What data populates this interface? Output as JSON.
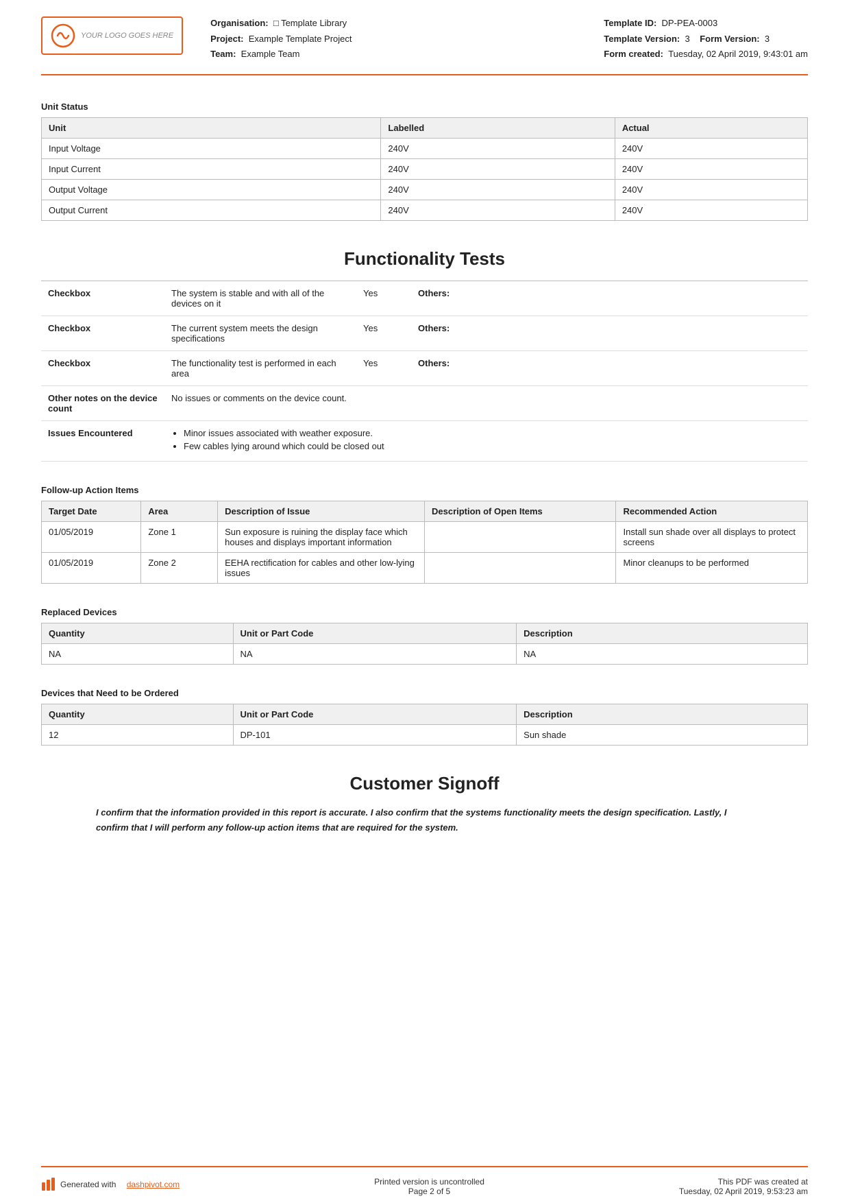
{
  "header": {
    "logo_text": "YOUR LOGO GOES HERE",
    "organisation_label": "Organisation:",
    "organisation_value": "Template Library",
    "project_label": "Project:",
    "project_value": "Example Template Project",
    "team_label": "Team:",
    "team_value": "Example Team",
    "template_id_label": "Template ID:",
    "template_id_value": "DP-PEA-0003",
    "template_version_label": "Template Version:",
    "template_version_value": "3",
    "form_version_label": "Form Version:",
    "form_version_value": "3",
    "form_created_label": "Form created:",
    "form_created_value": "Tuesday, 02 April 2019, 9:43:01 am"
  },
  "unit_status": {
    "section_title": "Unit Status",
    "columns": [
      "Unit",
      "Labelled",
      "Actual"
    ],
    "rows": [
      {
        "unit": "Input Voltage",
        "labelled": "240V",
        "actual": "240V"
      },
      {
        "unit": "Input Current",
        "labelled": "240V",
        "actual": "240V"
      },
      {
        "unit": "Output Voltage",
        "labelled": "240V",
        "actual": "240V"
      },
      {
        "unit": "Output Current",
        "labelled": "240V",
        "actual": "240V"
      }
    ]
  },
  "functionality_tests": {
    "section_title": "Functionality Tests",
    "rows": [
      {
        "field_label": "Checkbox",
        "description": "The system is stable and with all of the devices on it",
        "value": "Yes",
        "others_label": "Others:"
      },
      {
        "field_label": "Checkbox",
        "description": "The current system meets the design specifications",
        "value": "Yes",
        "others_label": "Others:"
      },
      {
        "field_label": "Checkbox",
        "description": "The functionality test is performed in each area",
        "value": "Yes",
        "others_label": "Others:"
      },
      {
        "field_label": "Other notes on the device count",
        "description": "No issues or comments on the device count.",
        "value": "",
        "others_label": ""
      }
    ],
    "issues_label": "Issues Encountered",
    "issues_bullets": [
      "Minor issues associated with weather exposure.",
      "Few cables lying around which could be closed out"
    ]
  },
  "followup": {
    "section_title": "Follow-up Action Items",
    "columns": [
      "Target Date",
      "Area",
      "Description of Issue",
      "Description of Open Items",
      "Recommended Action"
    ],
    "rows": [
      {
        "target_date": "01/05/2019",
        "area": "Zone 1",
        "description": "Sun exposure is ruining the display face which houses and displays important information",
        "open_items": "",
        "recommended": "Install sun shade over all displays to protect screens"
      },
      {
        "target_date": "01/05/2019",
        "area": "Zone 2",
        "description": "EEHA rectification for cables and other low-lying issues",
        "open_items": "",
        "recommended": "Minor cleanups to be performed"
      }
    ]
  },
  "replaced_devices": {
    "section_title": "Replaced Devices",
    "columns": [
      "Quantity",
      "Unit or Part Code",
      "Description"
    ],
    "rows": [
      {
        "quantity": "NA",
        "part_code": "NA",
        "description": "NA"
      }
    ]
  },
  "devices_ordered": {
    "section_title": "Devices that Need to be Ordered",
    "columns": [
      "Quantity",
      "Unit or Part Code",
      "Description"
    ],
    "rows": [
      {
        "quantity": "12",
        "part_code": "DP-101",
        "description": "Sun shade"
      }
    ]
  },
  "customer_signoff": {
    "section_title": "Customer Signoff",
    "text": "I confirm that the information provided in this report is accurate. I also confirm that the systems functionality meets the design specification. Lastly, I confirm that I will perform any follow-up action items that are required for the system."
  },
  "footer": {
    "generated_text": "Generated with",
    "link_text": "dashpivot.com",
    "uncontrolled_text": "Printed version is uncontrolled",
    "page_text": "Page 2 of 5",
    "created_text": "This PDF was created at",
    "created_date": "Tuesday, 02 April 2019, 9:53:23 am"
  }
}
